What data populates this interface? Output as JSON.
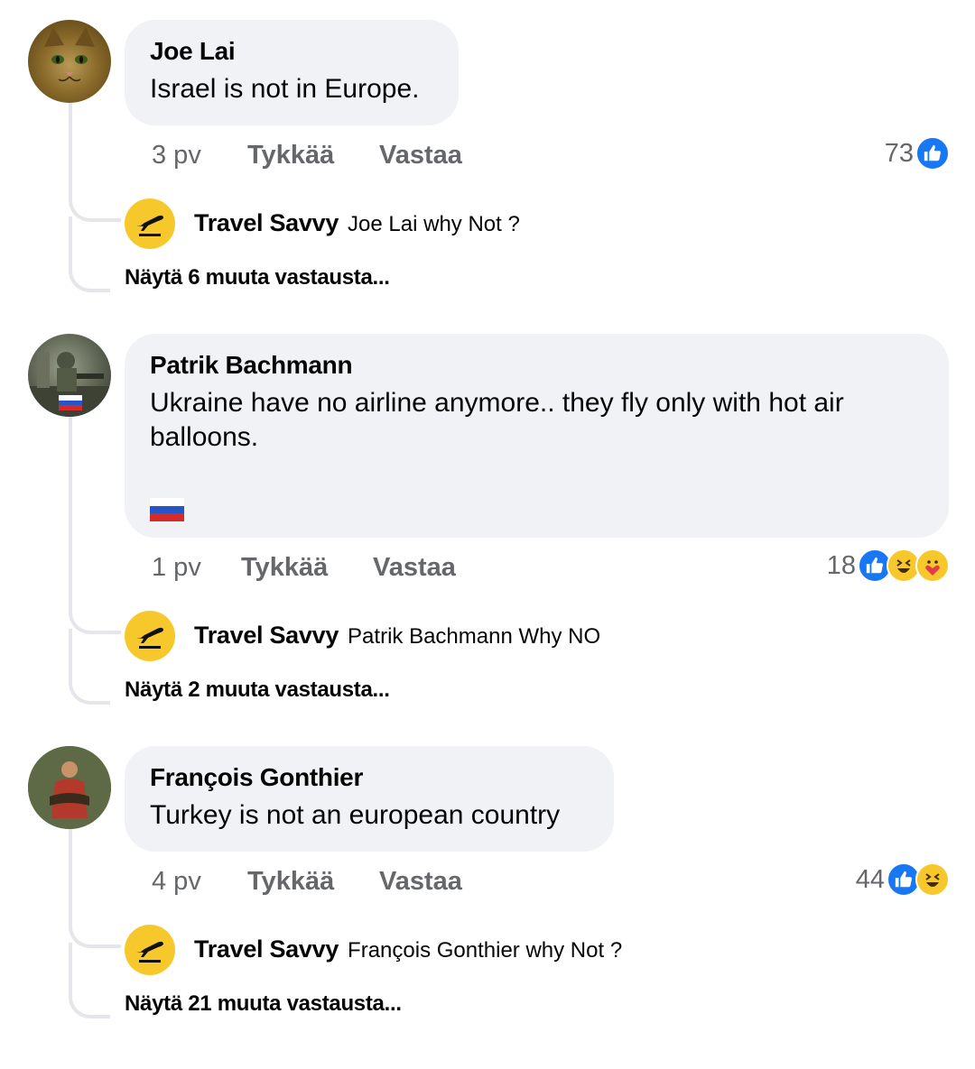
{
  "comments": [
    {
      "author": "Joe Lai",
      "text": "Israel is not in Europe.",
      "time": "3 pv",
      "like_label": "Tykkää",
      "reply_label": "Vastaa",
      "reaction_count": "73",
      "reactions": [
        "like-icon"
      ],
      "reply": {
        "author": "Travel Savvy",
        "text": "Joe Lai  why Not ?"
      },
      "more_replies": "Näytä 6 muuta vastausta..."
    },
    {
      "author": "Patrik Bachmann",
      "text": "Ukraine have no airline anymore.. they fly only with hot air balloons.",
      "time": "1 pv",
      "like_label": "Tykkää",
      "reply_label": "Vastaa",
      "reaction_count": "18",
      "reactions": [
        "like-icon",
        "haha-icon",
        "care-icon"
      ],
      "reply": {
        "author": "Travel Savvy",
        "text": "Patrik Bachmann Why NO"
      },
      "more_replies": "Näytä 2 muuta vastausta..."
    },
    {
      "author": "François Gonthier",
      "text": "Turkey is not an european country",
      "time": "4 pv",
      "like_label": "Tykkää",
      "reply_label": "Vastaa",
      "reaction_count": "44",
      "reactions": [
        "like-icon",
        "haha-icon"
      ],
      "reply": {
        "author": "Travel Savvy",
        "text": "François Gonthier  why Not ?"
      },
      "more_replies": "Näytä 21 muuta vastausta..."
    }
  ],
  "colors": {
    "bubble": "#f0f2f5",
    "meta_text": "#65676b",
    "like_blue": "#1877f2",
    "travel_savvy_yellow": "#f7c82c"
  }
}
